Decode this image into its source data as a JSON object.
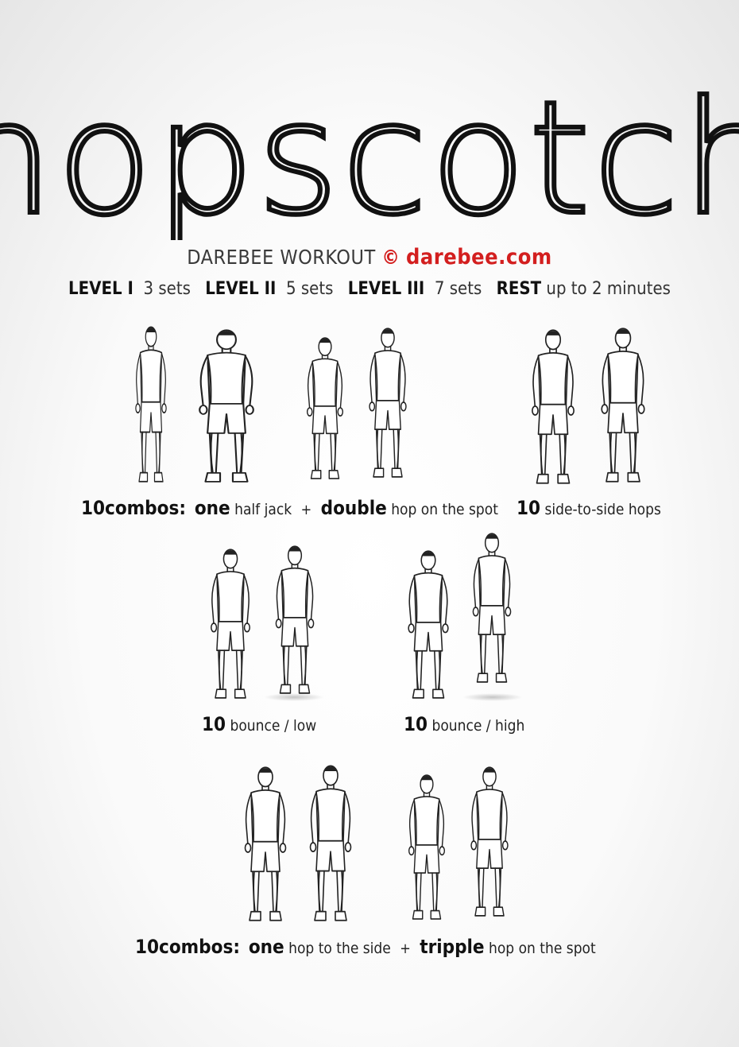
{
  "title": "hopscotch",
  "subtitle": {
    "prefix": "DAREBEE WORKOUT",
    "copyright": "©",
    "brand": "darebee.com"
  },
  "levels": [
    {
      "label": "LEVEL I",
      "value": "3 sets"
    },
    {
      "label": "LEVEL II",
      "value": "5 sets"
    },
    {
      "label": "LEVEL III",
      "value": "7 sets"
    },
    {
      "label": "REST",
      "value": "up to 2 minutes"
    }
  ],
  "exercises": {
    "e1": {
      "count": "10combos:",
      "w1": "one",
      "t1": "half jack",
      "plus": "+",
      "w2": "double",
      "t2": "hop on the spot"
    },
    "e2": {
      "count": "10",
      "text": "side-to-side hops"
    },
    "e3": {
      "count": "10",
      "text": "bounce  / low"
    },
    "e4": {
      "count": "10",
      "text": "bounce / high"
    },
    "e5": {
      "count": "10combos:",
      "w1": "one",
      "t1": "hop to the side",
      "plus": "+",
      "w2": "tripple",
      "t2": "hop on the spot"
    }
  }
}
